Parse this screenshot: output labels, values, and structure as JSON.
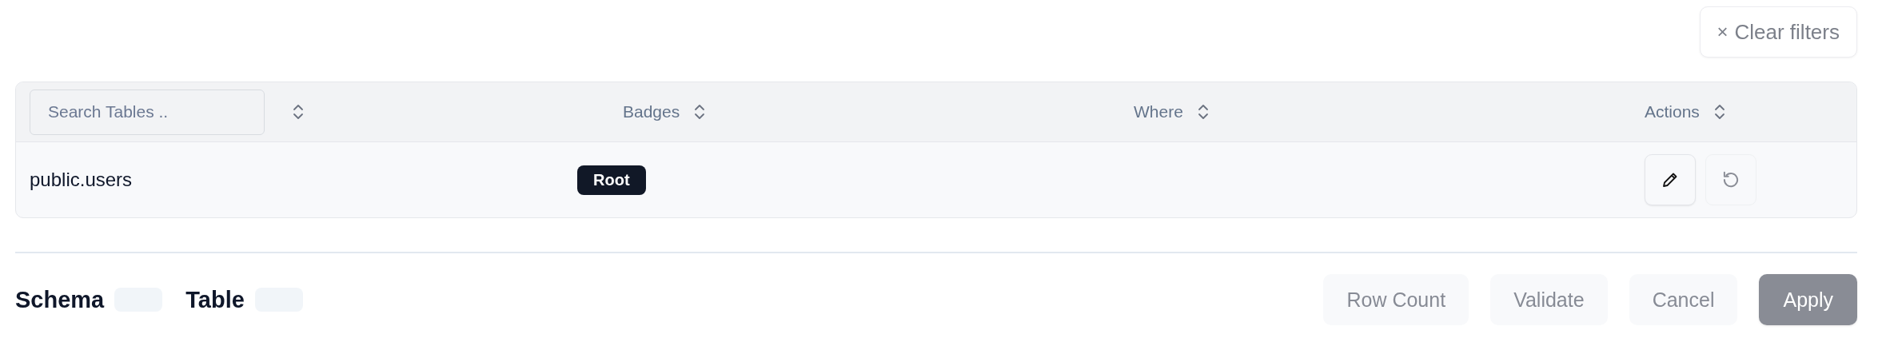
{
  "toolbar": {
    "clear_filters": {
      "icon": "×",
      "label": "Clear filters"
    }
  },
  "table": {
    "columns": [
      {
        "kind": "search",
        "placeholder": "Search Tables .."
      },
      {
        "kind": "header",
        "label": "Badges"
      },
      {
        "kind": "header",
        "label": "Where"
      },
      {
        "kind": "header",
        "label": "Actions"
      }
    ],
    "rows": [
      {
        "name": "public.users",
        "badges": [
          {
            "label": "Root"
          }
        ],
        "actions": [
          {
            "kind": "edit",
            "disabled": false
          },
          {
            "kind": "reset",
            "disabled": true
          }
        ]
      }
    ]
  },
  "footer": {
    "fields": [
      {
        "label": "Schema"
      },
      {
        "label": "Table"
      }
    ],
    "buttons": [
      {
        "label": "Row Count",
        "kind": "secondary",
        "disabled": true
      },
      {
        "label": "Validate",
        "kind": "secondary",
        "disabled": true
      },
      {
        "label": "Cancel",
        "kind": "secondary",
        "disabled": true
      },
      {
        "label": "Apply",
        "kind": "primary",
        "disabled": true
      }
    ]
  }
}
